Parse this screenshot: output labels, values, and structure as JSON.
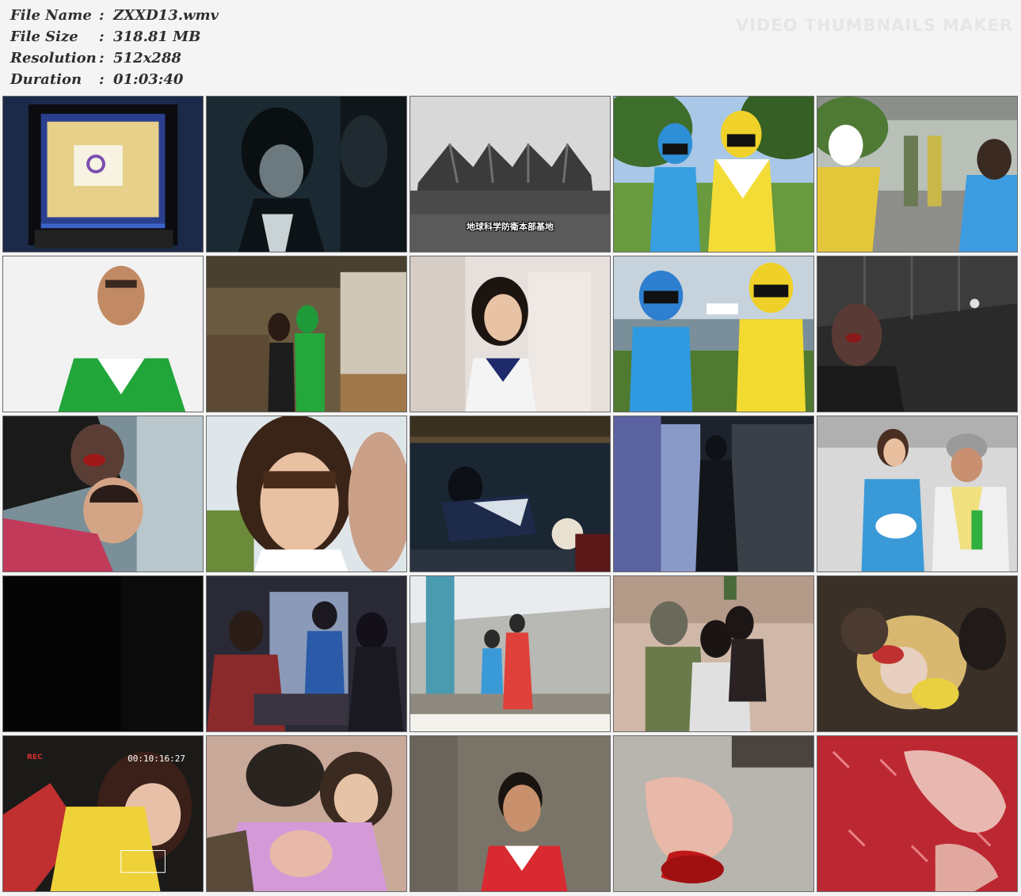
{
  "file_info": [
    {
      "label": "File Name",
      "value": "ZXXD13.wmv"
    },
    {
      "label": "File Size",
      "value": "318.81 MB"
    },
    {
      "label": "Resolution",
      "value": "512x288"
    },
    {
      "label": "Duration",
      "value": "01:03:40"
    }
  ],
  "watermark": "VIDEO THUMBNAILS MAKER",
  "watermark_sub": "",
  "captions": {
    "frame_3": "地球科学防衛本部基地",
    "frame_21_rec": "REC",
    "frame_21_timecode": "00:10:16:27"
  }
}
